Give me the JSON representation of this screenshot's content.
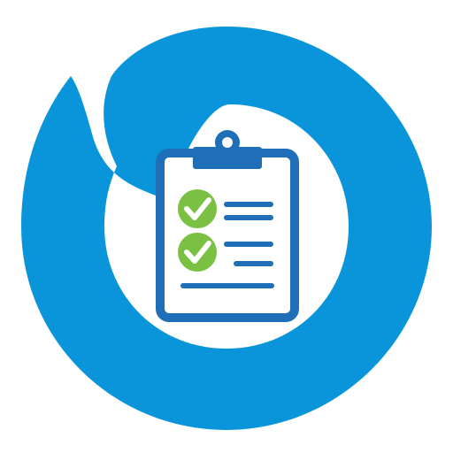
{
  "logo": {
    "icon": "clipboard-checklist-icon",
    "colors": {
      "ring": "#0A95DA",
      "clipboard": "#1E6FB8",
      "check": "#7AC143",
      "background": "#FFFFFF"
    },
    "checklist": {
      "items": [
        {
          "checked": true
        },
        {
          "checked": true
        },
        {
          "checked": false
        }
      ]
    }
  }
}
